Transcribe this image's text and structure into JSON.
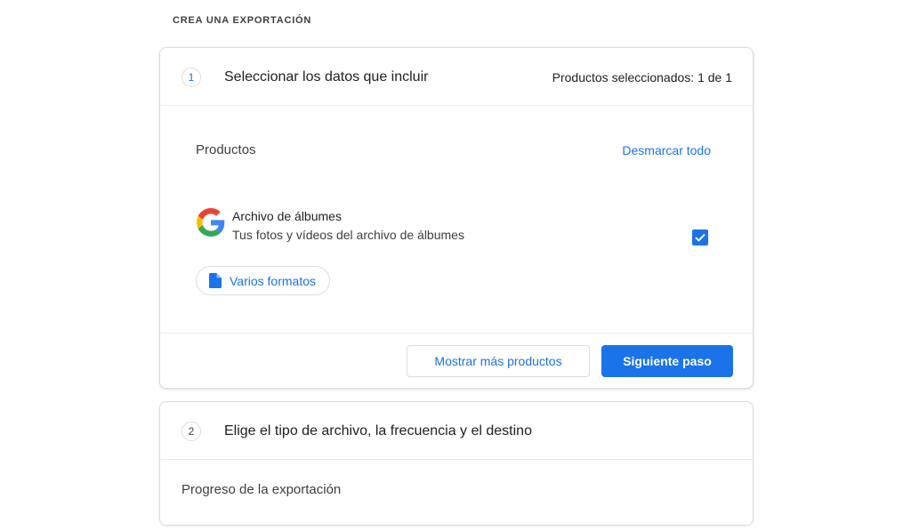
{
  "page": {
    "heading": "CREA UNA EXPORTACIÓN"
  },
  "step1": {
    "number": "1",
    "title": "Seleccionar los datos que incluir",
    "selected_count": "Productos seleccionados: 1 de 1",
    "products_label": "Productos",
    "deselect_all": "Desmarcar todo",
    "product": {
      "icon": "google-g-icon",
      "name": "Archivo de álbumes",
      "description": "Tus fotos y vídeos del archivo de álbumes",
      "checked": true
    },
    "format_chip": {
      "icon": "file-icon",
      "label": "Varios formatos"
    },
    "show_more_button": "Mostrar más productos",
    "next_button": "Siguiente paso"
  },
  "step2": {
    "number": "2",
    "title": "Elige el tipo de archivo, la frecuencia y el destino"
  },
  "progress": {
    "label": "Progreso de la exportación"
  },
  "colors": {
    "accent": "#1a73e8",
    "border": "#dadce0",
    "text": "#202124"
  }
}
